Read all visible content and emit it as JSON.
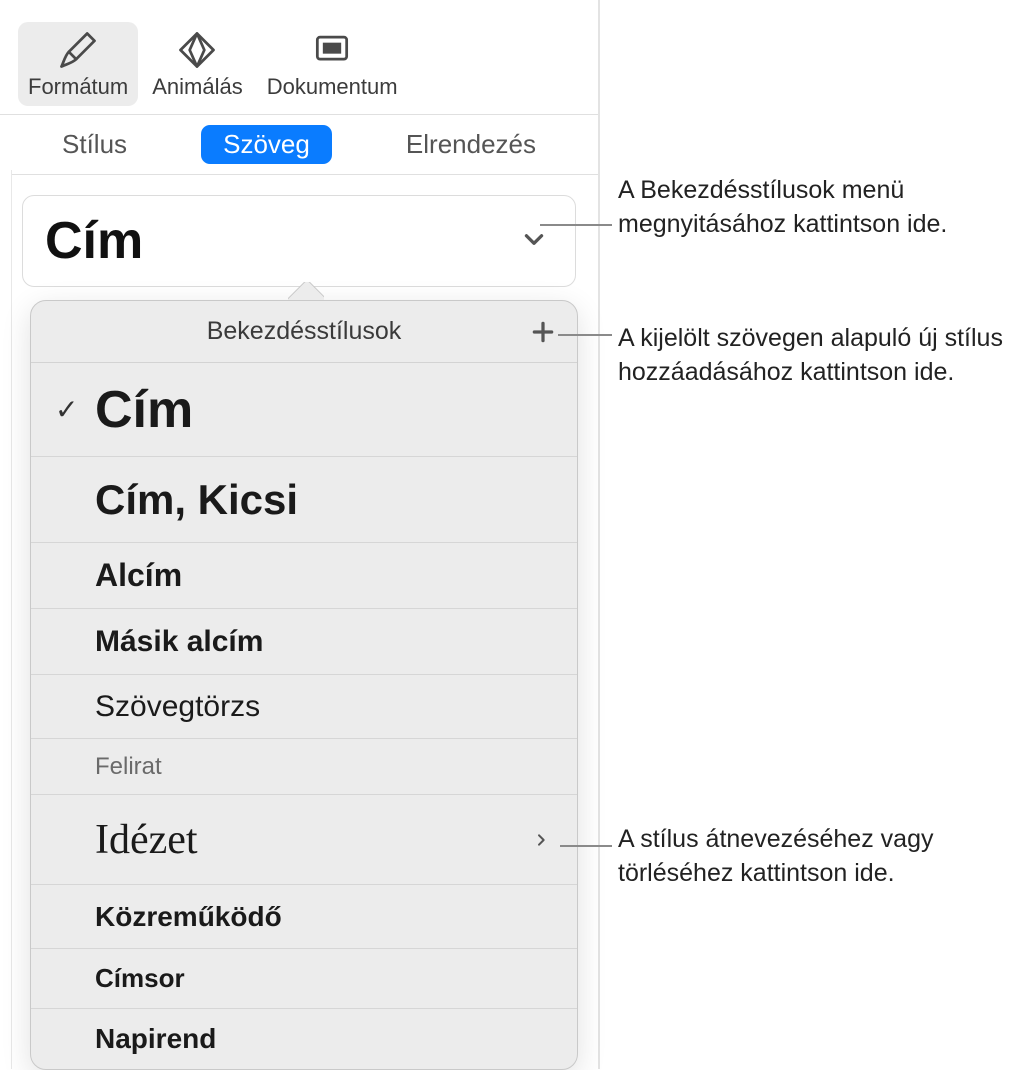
{
  "toolbar": {
    "items": [
      {
        "label": "Formátum",
        "icon": "paintbrush-icon",
        "selected": true
      },
      {
        "label": "Animálás",
        "icon": "diamond-icon",
        "selected": false
      },
      {
        "label": "Dokumentum",
        "icon": "document-icon",
        "selected": false
      }
    ]
  },
  "tabs": {
    "items": [
      {
        "label": "Stílus",
        "active": false
      },
      {
        "label": "Szöveg",
        "active": true
      },
      {
        "label": "Elrendezés",
        "active": false
      }
    ]
  },
  "currentStyle": "Cím",
  "popover": {
    "title": "Bekezdésstílusok",
    "styles": [
      {
        "name": "Cím",
        "checked": true,
        "hasSubmenu": false
      },
      {
        "name": "Cím, Kicsi",
        "checked": false,
        "hasSubmenu": false
      },
      {
        "name": "Alcím",
        "checked": false,
        "hasSubmenu": false
      },
      {
        "name": "Másik alcím",
        "checked": false,
        "hasSubmenu": false
      },
      {
        "name": "Szövegtörzs",
        "checked": false,
        "hasSubmenu": false
      },
      {
        "name": "Felirat",
        "checked": false,
        "hasSubmenu": false
      },
      {
        "name": "Idézet",
        "checked": false,
        "hasSubmenu": true
      },
      {
        "name": "Közreműködő",
        "checked": false,
        "hasSubmenu": false
      },
      {
        "name": "Címsor",
        "checked": false,
        "hasSubmenu": false
      },
      {
        "name": "Napirend",
        "checked": false,
        "hasSubmenu": false
      }
    ]
  },
  "callouts": {
    "c1": "A Bekezdésstílusok menü megnyitásához kattintson ide.",
    "c2": "A kijelölt szövegen alapuló új stílus hozzáadásához kattintson ide.",
    "c3": "A stílus átnevezéséhez vagy törléséhez kattintson ide."
  }
}
